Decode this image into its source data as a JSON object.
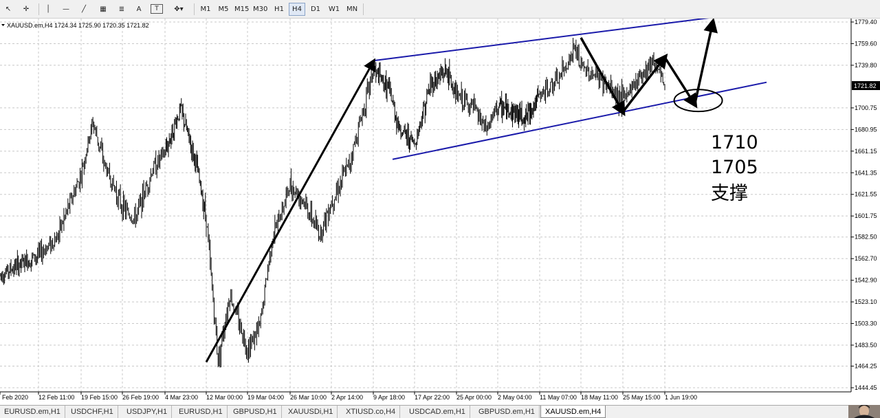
{
  "toolbar": {
    "tools": [
      {
        "icon": "cursor-arrow-icon",
        "glyph": "↖"
      },
      {
        "icon": "crosshair-icon",
        "glyph": "✛"
      },
      {
        "icon": "vertical-line-icon",
        "glyph": "│"
      },
      {
        "icon": "horizontal-line-icon",
        "glyph": "—"
      },
      {
        "icon": "trendline-icon",
        "glyph": "╱"
      },
      {
        "icon": "channel-icon",
        "glyph": "▦"
      },
      {
        "icon": "fibonacci-icon",
        "glyph": "≣"
      },
      {
        "icon": "text-icon",
        "glyph": "A"
      },
      {
        "icon": "text-label-icon",
        "glyph": "T"
      },
      {
        "icon": "shapes-dropdown-icon",
        "glyph": "✥▾"
      }
    ],
    "timeframes": [
      "M1",
      "M5",
      "M15",
      "M30",
      "H1",
      "H4",
      "D1",
      "W1",
      "MN"
    ],
    "active_timeframe": "H4"
  },
  "chart": {
    "header": "XAUUSD.em,H4  1724.34 1725.90 1720.35 1721.82",
    "current_price": "1721.82",
    "annotations": [
      "1710",
      "1705",
      "支撑"
    ]
  },
  "chart_data": {
    "type": "candlestick",
    "symbol": "XAUUSD.em,H4",
    "ohlc": {
      "open": 1724.34,
      "high": 1725.9,
      "low": 1720.35,
      "close": 1721.82
    },
    "y_ticks": [
      "1779.40",
      "1759.60",
      "1739.80",
      "1721.82",
      "1700.75",
      "1680.95",
      "1661.15",
      "1641.35",
      "1621.55",
      "1601.75",
      "1582.50",
      "1562.70",
      "1542.90",
      "1523.10",
      "1503.30",
      "1483.50",
      "1464.25",
      "1444.45"
    ],
    "x_ticks": [
      "Feb 2020",
      "12 Feb 11:00",
      "19 Feb 15:00",
      "26 Feb 19:00",
      "4 Mar 23:00",
      "12 Mar 00:00",
      "19 Mar 04:00",
      "26 Mar 10:00",
      "2 Apr 14:00",
      "9 Apr 18:00",
      "17 Apr 22:00",
      "25 Apr 00:00",
      "2 May 04:00",
      "11 May 07:00",
      "18 May 11:00",
      "25 May 15:00",
      "1 Jun 19:00"
    ],
    "price_path": [
      {
        "t": "Feb 2020",
        "p": 1548
      },
      {
        "t": "12 Feb 11:00",
        "p": 1566
      },
      {
        "t": "15 Feb",
        "p": 1582
      },
      {
        "t": "19 Feb 15:00",
        "p": 1640
      },
      {
        "t": "21 Feb",
        "p": 1688
      },
      {
        "t": "23 Feb",
        "p": 1648
      },
      {
        "t": "26 Feb 19:00",
        "p": 1610
      },
      {
        "t": "28 Feb",
        "p": 1598
      },
      {
        "t": "2 Mar",
        "p": 1645
      },
      {
        "t": "4 Mar 23:00",
        "p": 1660
      },
      {
        "t": "7 Mar",
        "p": 1700
      },
      {
        "t": "10 Mar",
        "p": 1650
      },
      {
        "t": "12 Mar 00:00",
        "p": 1600
      },
      {
        "t": "14 Mar",
        "p": 1470
      },
      {
        "t": "16 Mar",
        "p": 1530
      },
      {
        "t": "19 Mar 04:00",
        "p": 1480
      },
      {
        "t": "21 Mar",
        "p": 1500
      },
      {
        "t": "23 Mar",
        "p": 1580
      },
      {
        "t": "26 Mar 10:00",
        "p": 1630
      },
      {
        "t": "28 Mar",
        "p": 1618
      },
      {
        "t": "31 Mar",
        "p": 1585
      },
      {
        "t": "2 Apr 14:00",
        "p": 1615
      },
      {
        "t": "5 Apr",
        "p": 1650
      },
      {
        "t": "9 Apr 18:00",
        "p": 1735
      },
      {
        "t": "12 Apr",
        "p": 1718
      },
      {
        "t": "14 Apr",
        "p": 1682
      },
      {
        "t": "17 Apr 22:00",
        "p": 1668
      },
      {
        "t": "20 Apr",
        "p": 1722
      },
      {
        "t": "23 Apr",
        "p": 1735
      },
      {
        "t": "25 Apr 00:00",
        "p": 1712
      },
      {
        "t": "28 Apr",
        "p": 1700
      },
      {
        "t": "30 Apr",
        "p": 1680
      },
      {
        "t": "2 May 04:00",
        "p": 1702
      },
      {
        "t": "5 May",
        "p": 1698
      },
      {
        "t": "8 May",
        "p": 1692
      },
      {
        "t": "11 May 07:00",
        "p": 1712
      },
      {
        "t": "14 May",
        "p": 1725
      },
      {
        "t": "17 May",
        "p": 1755
      },
      {
        "t": "18 May 11:00",
        "p": 1738
      },
      {
        "t": "21 May",
        "p": 1728
      },
      {
        "t": "23 May",
        "p": 1718
      },
      {
        "t": "25 May 15:00",
        "p": 1708
      },
      {
        "t": "28 May",
        "p": 1732
      },
      {
        "t": "30 May",
        "p": 1745
      },
      {
        "t": "1 Jun 19:00",
        "p": 1722
      }
    ],
    "trendlines": [
      {
        "name": "channel-upper",
        "color": "#1a1aaa",
        "from": {
          "t": "9 Apr 18:00",
          "p": 1744
        },
        "to": {
          "t": "1 Jun 19:00",
          "p": 1778
        }
      },
      {
        "name": "channel-lower",
        "color": "#1a1aaa",
        "from": {
          "t": "9 Apr 18:00",
          "p": 1650
        },
        "to": {
          "t": "1 Jun 19:00",
          "p": 1705
        }
      }
    ],
    "arrows": [
      {
        "from": {
          "t": "12 Mar 00:00",
          "p": 1468
        },
        "to": {
          "t": "9 Apr 18:00",
          "p": 1743
        }
      },
      {
        "from": {
          "t": "18 May 11:00",
          "p": 1765
        },
        "to": {
          "t": "25 May 15:00",
          "p": 1697
        }
      },
      {
        "from": {
          "t": "25 May 15:00",
          "p": 1697
        },
        "to": {
          "t": "1 Jun 19:00",
          "p": 1747
        }
      },
      {
        "from": {
          "t": "1 Jun 19:00",
          "p": 1747
        },
        "to": {
          "t": "6 Jun",
          "p": 1704
        }
      },
      {
        "from": {
          "t": "6 Jun",
          "p": 1704
        },
        "to": {
          "t": "9 Jun",
          "p": 1779
        }
      }
    ],
    "circle_marker": {
      "t": "6 Jun",
      "p": 1705
    },
    "colors": {
      "background": "#ffffff",
      "grid": "#c8c8c8",
      "candles": "#000000",
      "channel": "#1a1aaa",
      "arrows": "#000000"
    }
  },
  "tabs": [
    "EURUSD.em,H1",
    "USDCHF,H1",
    "USDJPY,H1",
    "EURUSD,H1",
    "GBPUSD,H1",
    "XAUUSDi,H1",
    "XTIUSD.co,H4",
    "USDCAD.em,H1",
    "GBPUSD.em,H1",
    "XAUUSD.em,H4"
  ],
  "active_tab": "XAUUSD.em,H4"
}
